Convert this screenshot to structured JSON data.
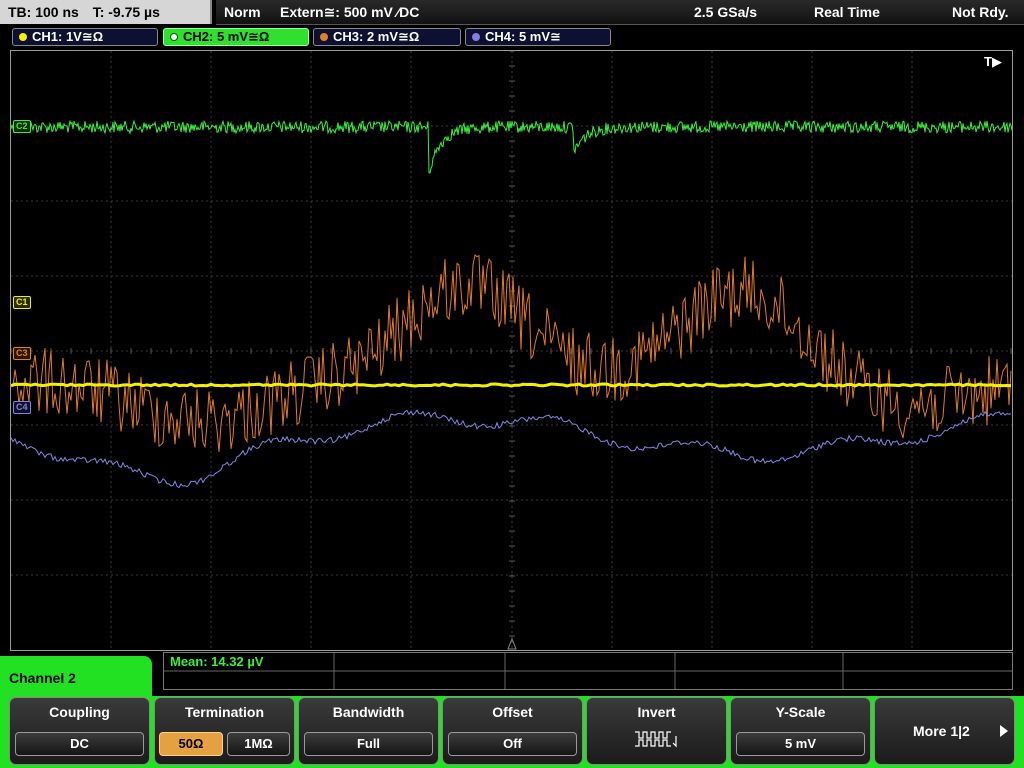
{
  "status": {
    "timebase": "TB: 100 ns",
    "trigger_time": "T: -9.75 µs",
    "mode": "Norm",
    "trigger": "Extern≅: 500 mV ⁄DC",
    "sample_rate": "2.5 GSa/s",
    "acquisition": "Real Time",
    "state": "Not Rdy."
  },
  "channels": [
    {
      "label": "CH1: 1V≅Ω",
      "color": "#f2f200"
    },
    {
      "label": "CH2: 5 mV≅Ω",
      "color": "#39f039",
      "active": true
    },
    {
      "label": "CH3: 2 mV≅Ω",
      "color": "#e0802a"
    },
    {
      "label": "CH4: 5 mV≅",
      "color": "#8080e0"
    }
  ],
  "trace_markers": {
    "c1": "C1",
    "c2": "C2",
    "c3": "C3",
    "c4": "C4",
    "trigger": "T▶"
  },
  "measurement": {
    "mean": "Mean: 14.32 µV"
  },
  "menu": {
    "channel_title": "Channel 2",
    "coupling": {
      "title": "Coupling",
      "value": "DC"
    },
    "termination": {
      "title": "Termination",
      "opt1": "50Ω",
      "opt2": "1MΩ",
      "selected": "50Ω"
    },
    "bandwidth": {
      "title": "Bandwidth",
      "value": "Full"
    },
    "offset": {
      "title": "Offset",
      "value": "Off"
    },
    "invert": {
      "title": "Invert",
      "icon": "invert-waveform-icon"
    },
    "yscale": {
      "title": "Y-Scale",
      "value": "5 mV"
    },
    "more": {
      "label": "More 1|2",
      "icon": "arrow-right-icon"
    }
  }
}
